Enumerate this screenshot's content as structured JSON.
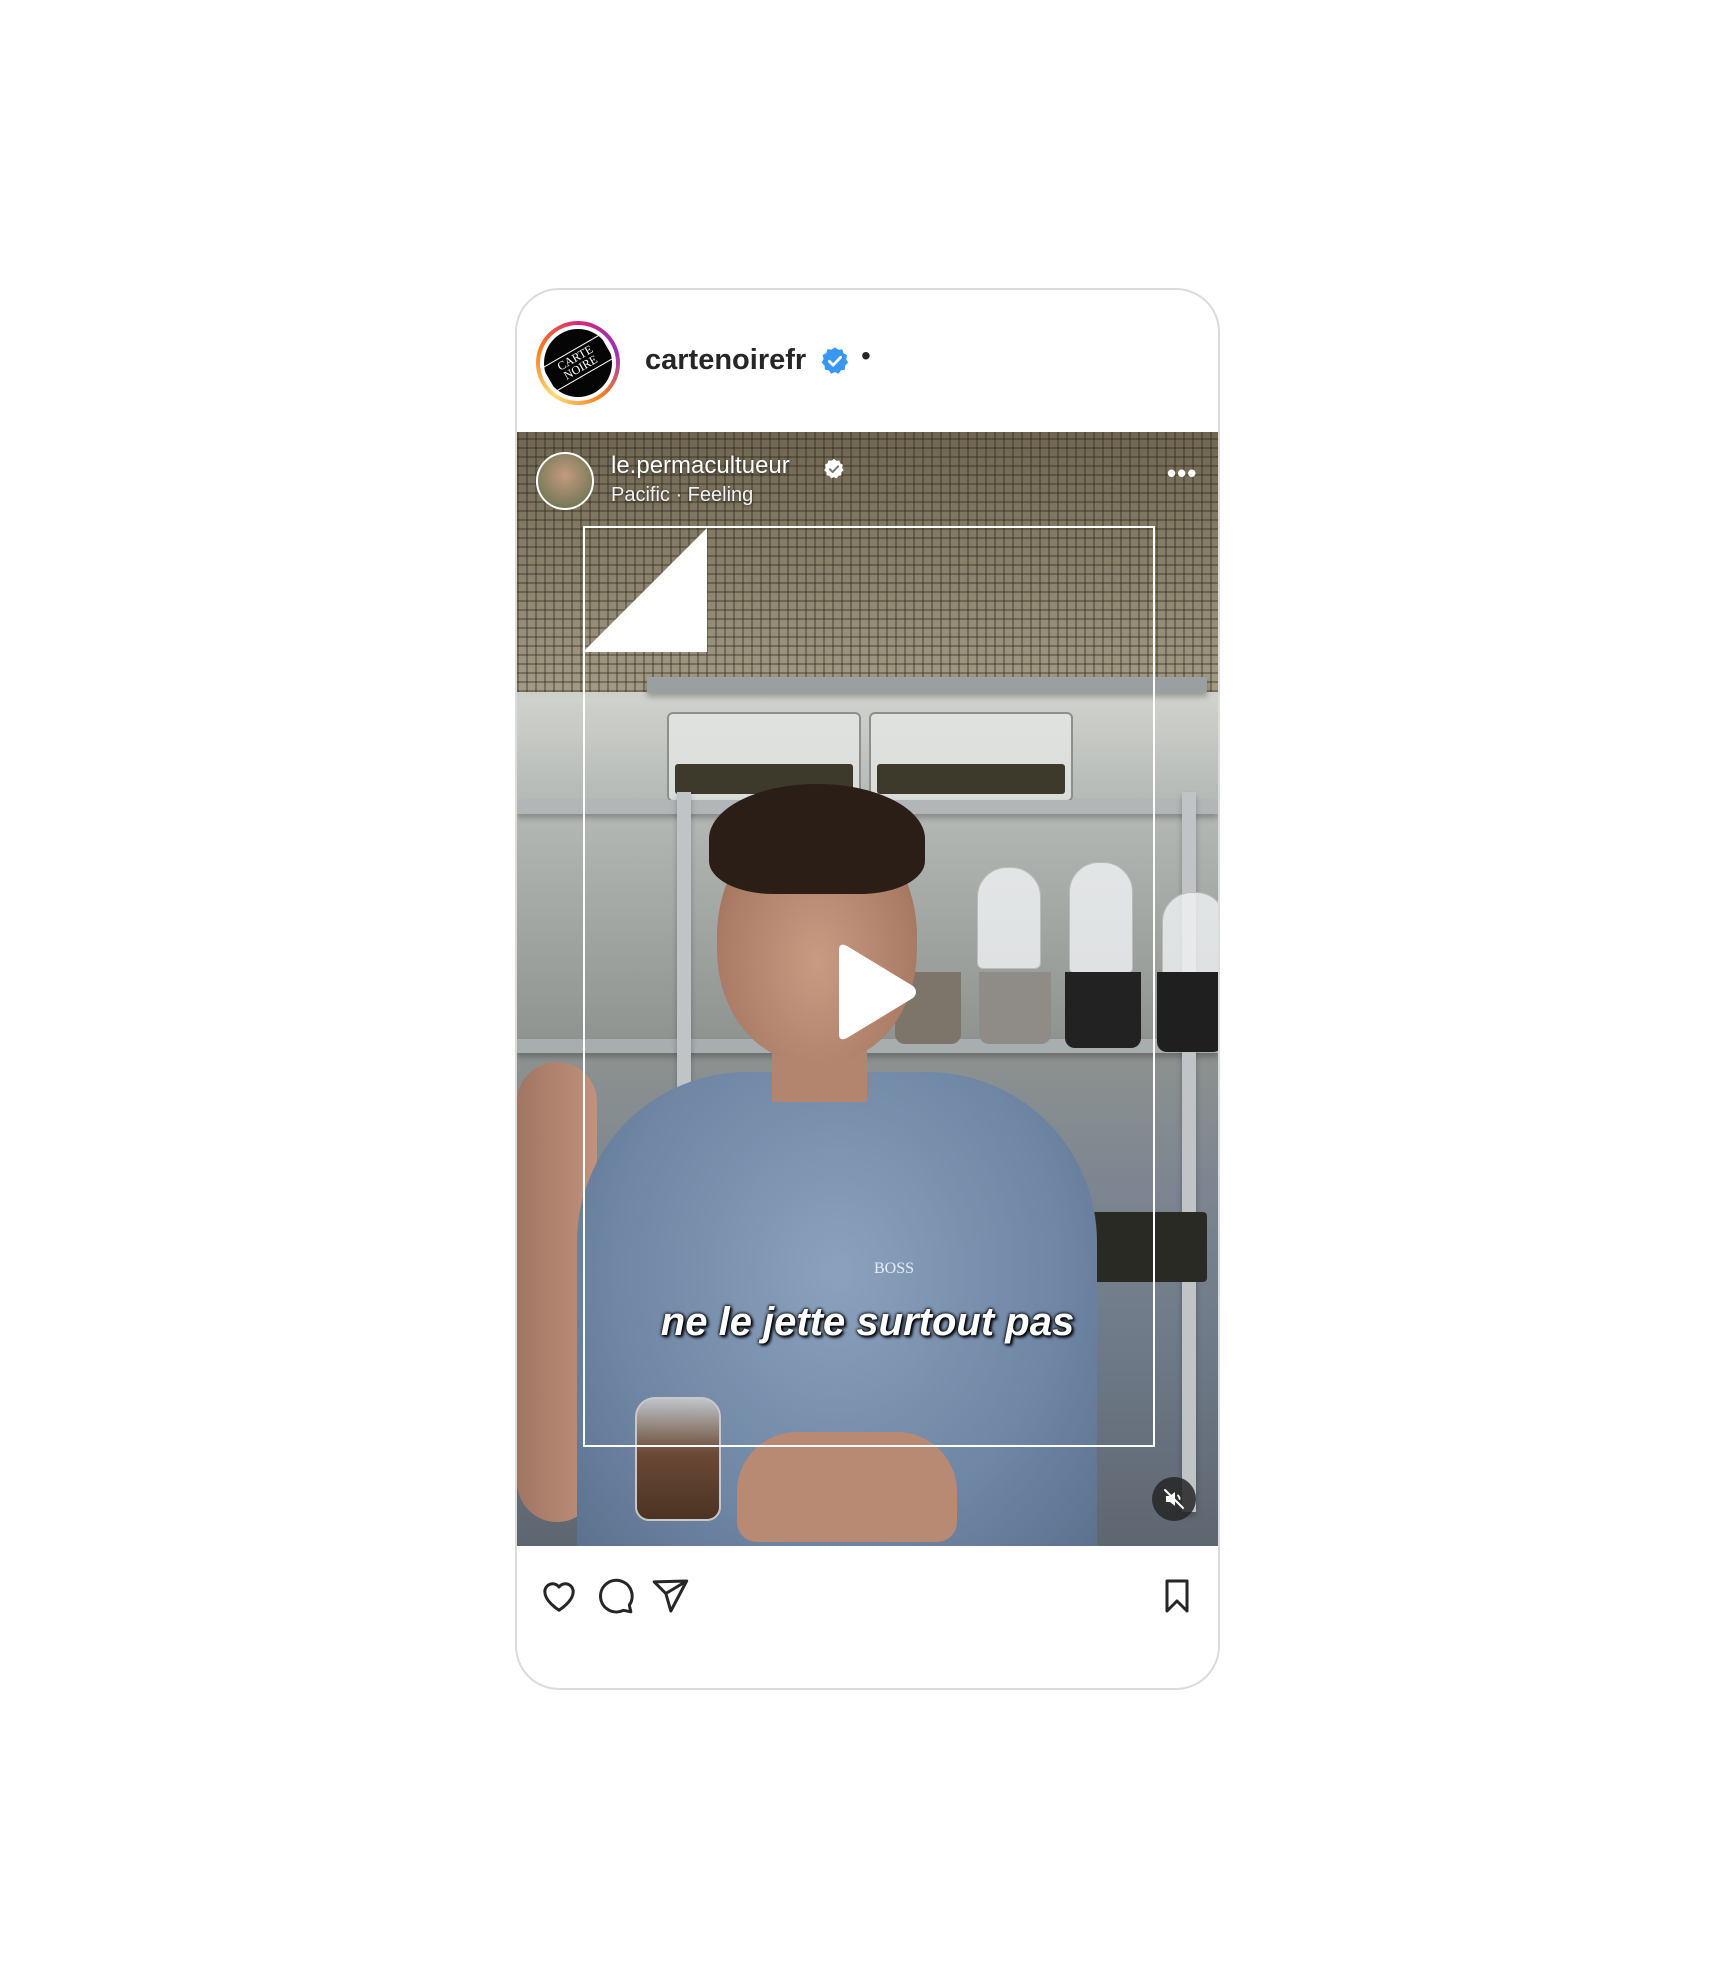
{
  "post": {
    "author": {
      "username": "cartenoirefr",
      "logo_text": "CARTE NOIRE",
      "verified": true,
      "separator": "•"
    }
  },
  "reel": {
    "author": {
      "username": "le.permacultueur",
      "verified": true
    },
    "audio": "Pacific · Feeling",
    "more_label": "•••",
    "subtitle": "ne le jette surtout pas",
    "shirt_brand": "BOSS",
    "muted": true
  },
  "icons": {
    "like": "heart-icon",
    "comment": "comment-icon",
    "share": "paper-plane-icon",
    "save": "bookmark-icon",
    "play": "play-icon",
    "mute": "speaker-muted-icon",
    "verified": "verified-badge-icon"
  },
  "colors": {
    "verified_blue": "#3897f0",
    "text_primary": "#262626",
    "border": "#dbdbdb"
  }
}
